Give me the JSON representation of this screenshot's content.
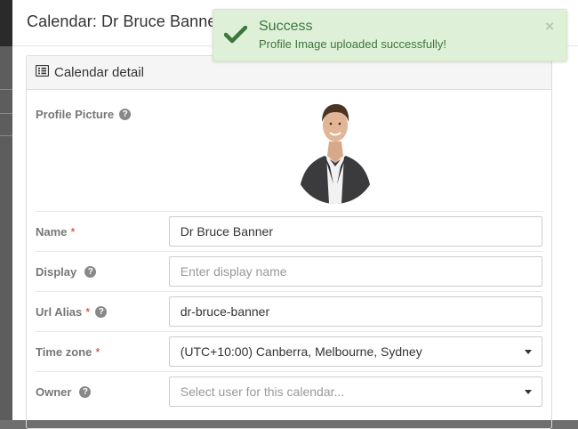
{
  "modal": {
    "title": "Calendar: Dr Bruce Banner"
  },
  "panel": {
    "heading": "Calendar detail",
    "heading_icon": "list-icon"
  },
  "fields": {
    "profile_picture": {
      "label": "Profile Picture",
      "help_icon": "question-circle-icon"
    },
    "name": {
      "label": "Name",
      "required": "*",
      "value": "Dr Bruce Banner"
    },
    "display": {
      "label": "Display",
      "placeholder": "Enter display name",
      "help_icon": "question-circle-icon"
    },
    "url_alias": {
      "label": "Url Alias",
      "required": "*",
      "value": "dr-bruce-banner",
      "help_icon": "question-circle-icon"
    },
    "time_zone": {
      "label": "Time zone",
      "required": "*",
      "value": "(UTC+10:00) Canberra, Melbourne, Sydney"
    },
    "owner": {
      "label": "Owner",
      "placeholder": "Select user for this calendar...",
      "help_icon": "question-circle-icon"
    }
  },
  "toast": {
    "title": "Success",
    "message": "Profile Image uploaded successfully!",
    "close": "×",
    "icon": "checkmark-icon",
    "colors": {
      "background": "#dff0d8",
      "text": "#3c763d"
    }
  },
  "help_glyph": "?"
}
